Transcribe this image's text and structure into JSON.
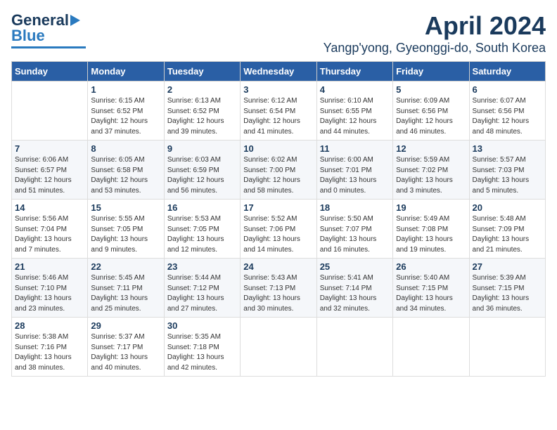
{
  "logo": {
    "line1": "General",
    "line2": "Blue"
  },
  "title": "April 2024",
  "subtitle": "Yangp'yong, Gyeonggi-do, South Korea",
  "days_of_week": [
    "Sunday",
    "Monday",
    "Tuesday",
    "Wednesday",
    "Thursday",
    "Friday",
    "Saturday"
  ],
  "weeks": [
    [
      {
        "day": "",
        "info": ""
      },
      {
        "day": "1",
        "info": "Sunrise: 6:15 AM\nSunset: 6:52 PM\nDaylight: 12 hours\nand 37 minutes."
      },
      {
        "day": "2",
        "info": "Sunrise: 6:13 AM\nSunset: 6:52 PM\nDaylight: 12 hours\nand 39 minutes."
      },
      {
        "day": "3",
        "info": "Sunrise: 6:12 AM\nSunset: 6:54 PM\nDaylight: 12 hours\nand 41 minutes."
      },
      {
        "day": "4",
        "info": "Sunrise: 6:10 AM\nSunset: 6:55 PM\nDaylight: 12 hours\nand 44 minutes."
      },
      {
        "day": "5",
        "info": "Sunrise: 6:09 AM\nSunset: 6:56 PM\nDaylight: 12 hours\nand 46 minutes."
      },
      {
        "day": "6",
        "info": "Sunrise: 6:07 AM\nSunset: 6:56 PM\nDaylight: 12 hours\nand 48 minutes."
      }
    ],
    [
      {
        "day": "7",
        "info": "Sunrise: 6:06 AM\nSunset: 6:57 PM\nDaylight: 12 hours\nand 51 minutes."
      },
      {
        "day": "8",
        "info": "Sunrise: 6:05 AM\nSunset: 6:58 PM\nDaylight: 12 hours\nand 53 minutes."
      },
      {
        "day": "9",
        "info": "Sunrise: 6:03 AM\nSunset: 6:59 PM\nDaylight: 12 hours\nand 56 minutes."
      },
      {
        "day": "10",
        "info": "Sunrise: 6:02 AM\nSunset: 7:00 PM\nDaylight: 12 hours\nand 58 minutes."
      },
      {
        "day": "11",
        "info": "Sunrise: 6:00 AM\nSunset: 7:01 PM\nDaylight: 13 hours\nand 0 minutes."
      },
      {
        "day": "12",
        "info": "Sunrise: 5:59 AM\nSunset: 7:02 PM\nDaylight: 13 hours\nand 3 minutes."
      },
      {
        "day": "13",
        "info": "Sunrise: 5:57 AM\nSunset: 7:03 PM\nDaylight: 13 hours\nand 5 minutes."
      }
    ],
    [
      {
        "day": "14",
        "info": "Sunrise: 5:56 AM\nSunset: 7:04 PM\nDaylight: 13 hours\nand 7 minutes."
      },
      {
        "day": "15",
        "info": "Sunrise: 5:55 AM\nSunset: 7:05 PM\nDaylight: 13 hours\nand 9 minutes."
      },
      {
        "day": "16",
        "info": "Sunrise: 5:53 AM\nSunset: 7:05 PM\nDaylight: 13 hours\nand 12 minutes."
      },
      {
        "day": "17",
        "info": "Sunrise: 5:52 AM\nSunset: 7:06 PM\nDaylight: 13 hours\nand 14 minutes."
      },
      {
        "day": "18",
        "info": "Sunrise: 5:50 AM\nSunset: 7:07 PM\nDaylight: 13 hours\nand 16 minutes."
      },
      {
        "day": "19",
        "info": "Sunrise: 5:49 AM\nSunset: 7:08 PM\nDaylight: 13 hours\nand 19 minutes."
      },
      {
        "day": "20",
        "info": "Sunrise: 5:48 AM\nSunset: 7:09 PM\nDaylight: 13 hours\nand 21 minutes."
      }
    ],
    [
      {
        "day": "21",
        "info": "Sunrise: 5:46 AM\nSunset: 7:10 PM\nDaylight: 13 hours\nand 23 minutes."
      },
      {
        "day": "22",
        "info": "Sunrise: 5:45 AM\nSunset: 7:11 PM\nDaylight: 13 hours\nand 25 minutes."
      },
      {
        "day": "23",
        "info": "Sunrise: 5:44 AM\nSunset: 7:12 PM\nDaylight: 13 hours\nand 27 minutes."
      },
      {
        "day": "24",
        "info": "Sunrise: 5:43 AM\nSunset: 7:13 PM\nDaylight: 13 hours\nand 30 minutes."
      },
      {
        "day": "25",
        "info": "Sunrise: 5:41 AM\nSunset: 7:14 PM\nDaylight: 13 hours\nand 32 minutes."
      },
      {
        "day": "26",
        "info": "Sunrise: 5:40 AM\nSunset: 7:15 PM\nDaylight: 13 hours\nand 34 minutes."
      },
      {
        "day": "27",
        "info": "Sunrise: 5:39 AM\nSunset: 7:15 PM\nDaylight: 13 hours\nand 36 minutes."
      }
    ],
    [
      {
        "day": "28",
        "info": "Sunrise: 5:38 AM\nSunset: 7:16 PM\nDaylight: 13 hours\nand 38 minutes."
      },
      {
        "day": "29",
        "info": "Sunrise: 5:37 AM\nSunset: 7:17 PM\nDaylight: 13 hours\nand 40 minutes."
      },
      {
        "day": "30",
        "info": "Sunrise: 5:35 AM\nSunset: 7:18 PM\nDaylight: 13 hours\nand 42 minutes."
      },
      {
        "day": "",
        "info": ""
      },
      {
        "day": "",
        "info": ""
      },
      {
        "day": "",
        "info": ""
      },
      {
        "day": "",
        "info": ""
      }
    ]
  ]
}
